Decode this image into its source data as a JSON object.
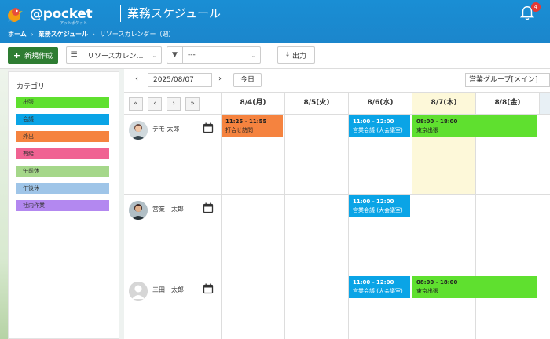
{
  "header": {
    "logo_text": "@pocket",
    "logo_sub": "アットポケット",
    "title": "業務スケジュール",
    "notification_count": "4"
  },
  "breadcrumb": [
    "ホーム",
    "業務スケジュール",
    "リソースカレンダー（週）"
  ],
  "toolbar": {
    "new_label": "新規作成",
    "view_select": "リソースカレン…",
    "filter_select": "---",
    "export_label": "出力"
  },
  "categories": {
    "title": "カテゴリ",
    "items": [
      {
        "label": "出張",
        "color": "#5fe02f"
      },
      {
        "label": "会議",
        "color": "#0aa4e6"
      },
      {
        "label": "外出",
        "color": "#f5833f"
      },
      {
        "label": "有給",
        "color": "#f06292"
      },
      {
        "label": "午前休",
        "color": "#a5d78a"
      },
      {
        "label": "午後休",
        "color": "#9fc5e8"
      },
      {
        "label": "社内作業",
        "color": "#b388f0"
      }
    ]
  },
  "calendar": {
    "date": "2025/08/07",
    "today_label": "今日",
    "group": "営業グループ[メイン]",
    "days": [
      "8/4(月)",
      "8/5(火)",
      "8/6(水)",
      "8/7(木)",
      "8/8(金)"
    ],
    "users": [
      {
        "name": "デモ 太郎"
      },
      {
        "name": "営業　太郎"
      },
      {
        "name": "三田　太郎"
      }
    ],
    "events": [
      {
        "time": "11:25 - 11:55",
        "title": "打合せ訪問"
      },
      {
        "time": "11:00 - 12:00",
        "title": "営業会議 (大会議室)"
      },
      {
        "time": "08:00 - 18:00",
        "title": "東京出張"
      },
      {
        "time": "11:00 - 12:00",
        "title": "営業会議 (大会議室)"
      },
      {
        "time": "11:00 - 12:00",
        "title": "営業会議 (大会議室)"
      },
      {
        "time": "08:00 - 18:00",
        "title": "東京出張"
      }
    ]
  }
}
